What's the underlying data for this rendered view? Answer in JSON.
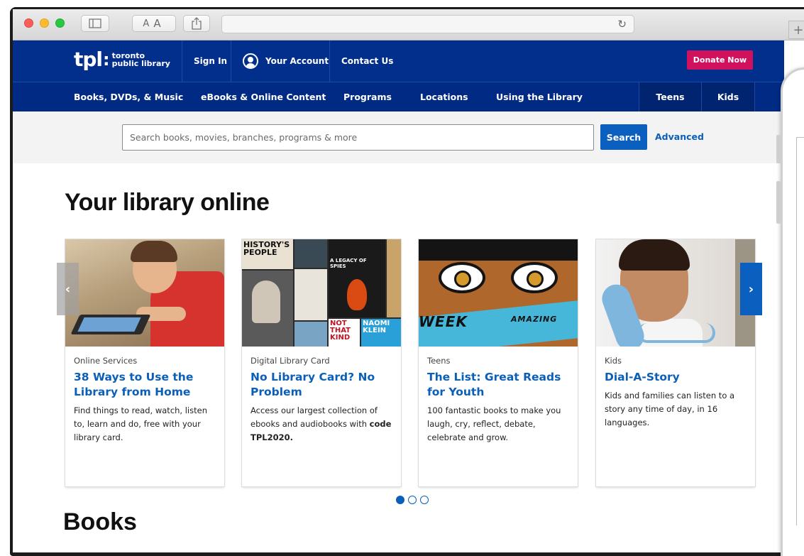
{
  "browser": {
    "font_size_buttons": [
      "A",
      "A"
    ]
  },
  "site": {
    "logo_mark": "tpl",
    "logo_line1": "toronto",
    "logo_line2": "public library",
    "topnav": {
      "sign_in": "Sign In",
      "your_account": "Your Account",
      "contact_us": "Contact Us",
      "donate": "Donate Now"
    },
    "subnav": {
      "books": "Books, DVDs, & Music",
      "ebooks": "eBooks & Online Content",
      "programs": "Programs",
      "locations": "Locations",
      "using": "Using the Library",
      "teens": "Teens",
      "kids": "Kids"
    },
    "search": {
      "placeholder": "Search books, movies, branches, programs & more",
      "button": "Search",
      "advanced": "Advanced"
    }
  },
  "main": {
    "title": "Your library online",
    "cards": [
      {
        "category": "Online Services",
        "title": "38 Ways to Use the Library from Home",
        "description": "Find things to read, watch, listen to, learn and do, free with your library card."
      },
      {
        "category": "Digital Library Card",
        "title": "No Library Card? No Problem",
        "description": "Access our largest collection of ebooks and audiobooks with",
        "description_bold": "code TPL2020."
      },
      {
        "category": "Teens",
        "title": "The List: Great Reads for Youth",
        "description": "100 fantastic books to make you laugh, cry, reflect, debate, celebrate and grow."
      },
      {
        "category": "Kids",
        "title": "Dial-A-Story",
        "description": "Kids and families can listen to a story any time of day, in 16 languages."
      }
    ],
    "book_cover_text": [
      "HISTORY'S PEOPLE",
      "A LEGACY OF SPIES",
      "NOT THAT KIND",
      "NAOMI KLEIN"
    ],
    "teens_cover_text": [
      "WEEK",
      "AMAZING"
    ],
    "carousel_prev": "‹",
    "carousel_next": "›",
    "books_heading": "Books"
  },
  "colors": {
    "primary_nav": "#022f8c",
    "donate": "#d0115e",
    "link_blue": "#0b5fb8",
    "search_button": "#0b60bf"
  }
}
